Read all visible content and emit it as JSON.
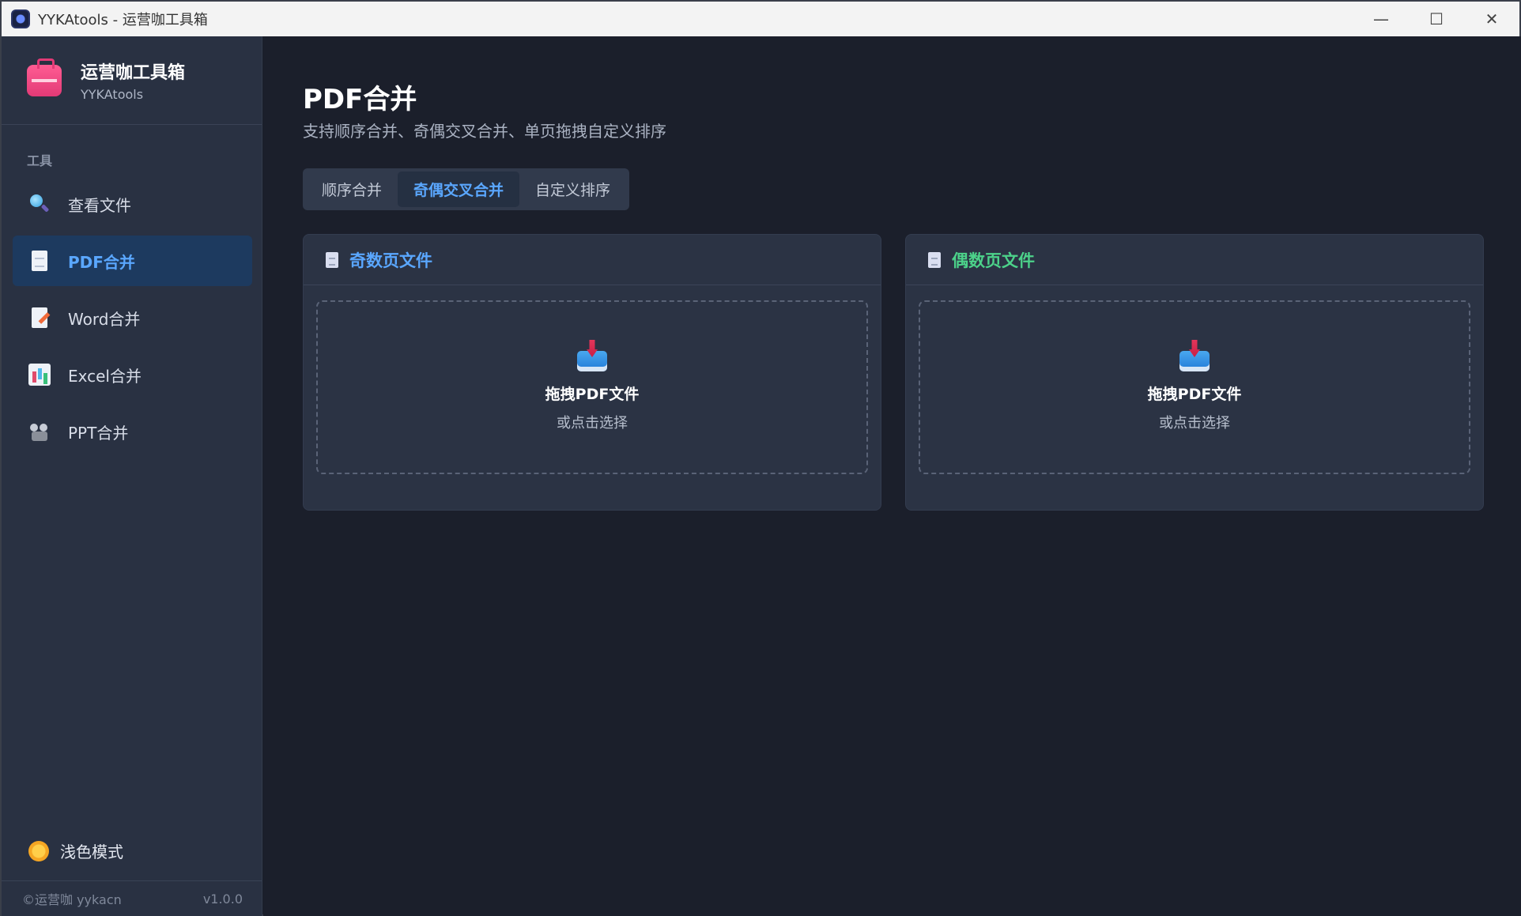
{
  "window": {
    "title": "YYKAtools - 运营咖工具箱",
    "controls": {
      "minimize": "—",
      "maximize": "☐",
      "close": "✕"
    }
  },
  "sidebar": {
    "brand_title": "运营咖工具箱",
    "brand_subtitle": "YYKAtools",
    "section_label": "工具",
    "items": [
      {
        "label": "查看文件",
        "icon": "search-icon"
      },
      {
        "label": "PDF合并",
        "icon": "document-icon",
        "active": true
      },
      {
        "label": "Word合并",
        "icon": "word-document-icon"
      },
      {
        "label": "Excel合并",
        "icon": "spreadsheet-chart-icon"
      },
      {
        "label": "PPT合并",
        "icon": "projector-icon"
      }
    ],
    "theme_toggle": "浅色模式",
    "footer": {
      "copyright": "©运营咖 yykacn",
      "version": "v1.0.0"
    }
  },
  "main": {
    "title": "PDF合并",
    "subtitle": "支持顺序合并、奇偶交叉合并、单页拖拽自定义排序",
    "tabs": [
      {
        "label": "顺序合并"
      },
      {
        "label": "奇偶交叉合并",
        "active": true
      },
      {
        "label": "自定义排序"
      }
    ],
    "panels": {
      "odd": {
        "title": "奇数页文件",
        "drop_title": "拖拽PDF文件",
        "drop_sub": "或点击选择"
      },
      "even": {
        "title": "偶数页文件",
        "drop_title": "拖拽PDF文件",
        "drop_sub": "或点击选择"
      }
    }
  },
  "colors": {
    "accent_blue": "#5aa7ff",
    "accent_green": "#4cd28a",
    "sidebar_bg": "#293142",
    "main_bg": "#1b1f2b"
  }
}
